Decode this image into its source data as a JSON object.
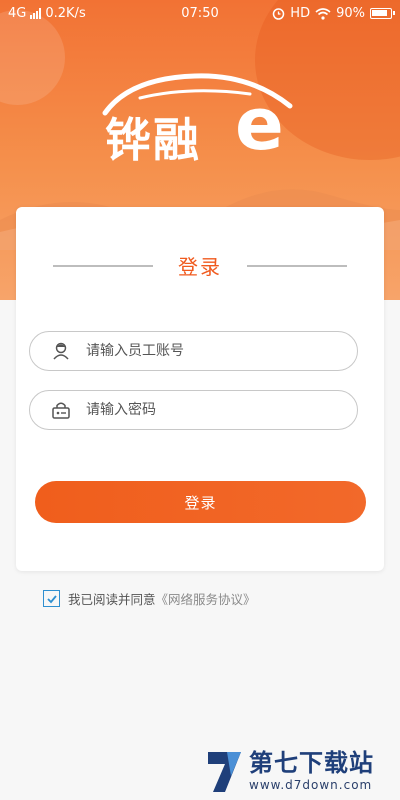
{
  "status_bar": {
    "network": "4G",
    "speed": "0.2K/s",
    "time": "07:50",
    "hd": "HD",
    "battery": "90%",
    "battery_level": 0.9
  },
  "app": {
    "logo_text": "铧融",
    "logo_letter": "e"
  },
  "login": {
    "title": "登录",
    "username_placeholder": "请输入员工账号",
    "password_placeholder": "请输入密码",
    "submit_label": "登录"
  },
  "agreement": {
    "checked": true,
    "text": "我已阅读并同意",
    "link": "《网络服务协议》"
  },
  "watermark": {
    "name": "第七下载站",
    "url": "www.d7down.com"
  },
  "colors": {
    "brand": "#f05a1e",
    "header_top": "#f27234",
    "checkbox": "#2f8fd0"
  }
}
